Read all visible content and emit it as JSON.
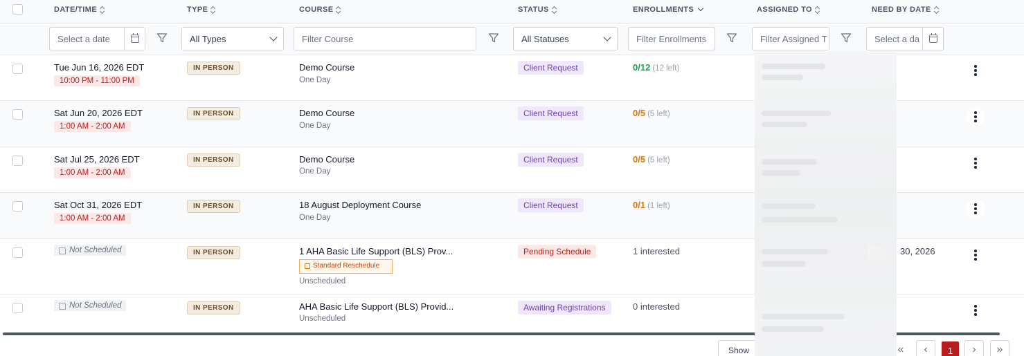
{
  "columns": {
    "datetime": "DATE/TIME",
    "type": "TYPE",
    "course": "COURSE",
    "status": "STATUS",
    "enrollments": "ENROLLMENTS",
    "assigned_to": "ASSIGNED TO",
    "need_by_date": "NEED BY DATE"
  },
  "filters": {
    "date_placeholder": "Select a date",
    "type_value": "All Types",
    "course_placeholder": "Filter Course",
    "status_value": "All Statuses",
    "enrollments_placeholder": "Filter Enrollments",
    "assigned_placeholder": "Filter Assigned T",
    "need_by_placeholder": "Select a da"
  },
  "rows": [
    {
      "date": "Tue Jun 16, 2026 EDT",
      "time": "10:00 PM - 11:00 PM",
      "type": "IN PERSON",
      "course": "Demo Course",
      "course_sub": "One Day",
      "status": "Client Request",
      "enroll_count": "0/12",
      "enroll_left": "(12 left)"
    },
    {
      "date": "Sat Jun 20, 2026 EDT",
      "time": "1:00 AM - 2:00 AM",
      "type": "IN PERSON",
      "course": "Demo Course",
      "course_sub": "One Day",
      "status": "Client Request",
      "enroll_count": "0/5",
      "enroll_left": "(5 left)"
    },
    {
      "date": "Sat Jul 25, 2026 EDT",
      "time": "1:00 AM - 2:00 AM",
      "type": "IN PERSON",
      "course": "Demo Course",
      "course_sub": "One Day",
      "status": "Client Request",
      "enroll_count": "0/5",
      "enroll_left": "(5 left)"
    },
    {
      "date": "Sat Oct 31, 2026 EDT",
      "time": "1:00 AM - 2:00 AM",
      "type": "IN PERSON",
      "course": "18 August Deployment Course",
      "course_sub": "One Day",
      "status": "Client Request",
      "enroll_count": "0/1",
      "enroll_left": "(1 left)"
    },
    {
      "date": "Not Scheduled",
      "type": "IN PERSON",
      "course": "1 AHA Basic Life Support (BLS) Prov...",
      "reschedule": "Standard Reschedule",
      "course_sub": "Unscheduled",
      "status": "Pending Schedule",
      "interested": "1 interested",
      "need_by": "30, 2026"
    },
    {
      "date": "Not Scheduled",
      "type": "IN PERSON",
      "course": "AHA Basic Life Support (BLS) Provid...",
      "course_sub": "Unscheduled",
      "status": "Awaiting Registrations",
      "interested": "0 interested"
    }
  ],
  "footer": {
    "show_label": "Show",
    "current_page": "1"
  }
}
